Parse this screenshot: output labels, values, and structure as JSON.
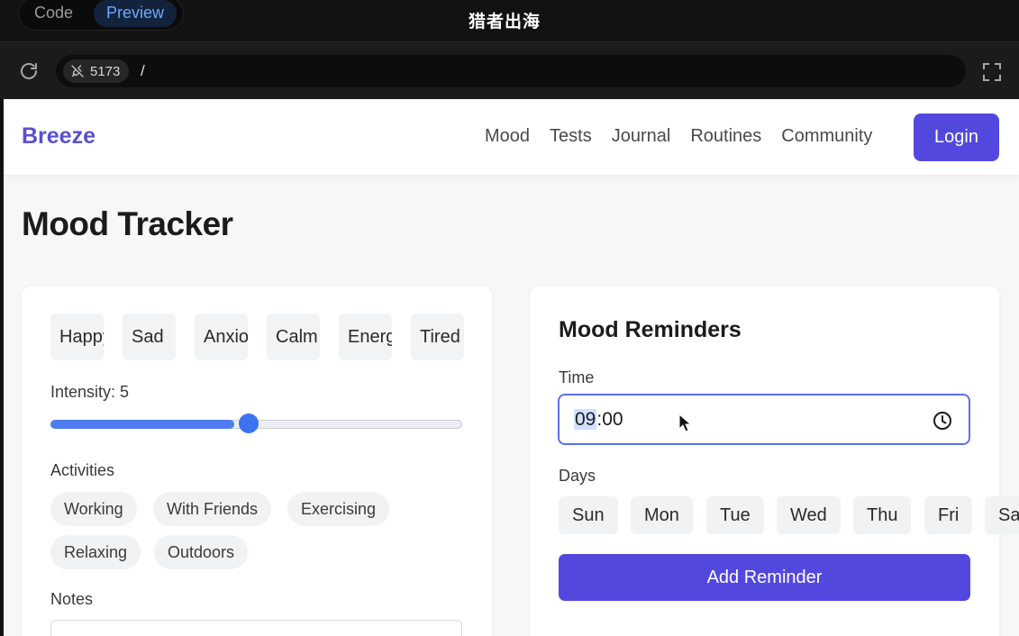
{
  "editor": {
    "tabs": {
      "code": "Code",
      "preview": "Preview"
    },
    "watermark": "猎者出海",
    "address": {
      "port": "5173",
      "path": "/"
    }
  },
  "app": {
    "brand": "Breeze",
    "nav": [
      "Mood",
      "Tests",
      "Journal",
      "Routines",
      "Community"
    ],
    "login_label": "Login",
    "page_title": "Mood Tracker",
    "moods": [
      "Happy",
      "Sad",
      "Anxious",
      "Calm",
      "Energetic",
      "Tired"
    ],
    "intensity": {
      "label": "Intensity: 5",
      "value": 5,
      "min": 1,
      "max": 10
    },
    "activities_label": "Activities",
    "activities": [
      "Working",
      "With Friends",
      "Exercising",
      "Relaxing",
      "Outdoors"
    ],
    "notes_label": "Notes",
    "reminders": {
      "title": "Mood Reminders",
      "time_label": "Time",
      "time_hour": "09",
      "time_rest": ":00",
      "days_label": "Days",
      "days": [
        "Sun",
        "Mon",
        "Tue",
        "Wed",
        "Thu",
        "Fri",
        "Sa"
      ],
      "add_label": "Add Reminder"
    }
  },
  "colors": {
    "brand": "#5a4fcf",
    "primary_button": "#5348dd",
    "slider": "#4d7df0",
    "focus_ring": "#5f6fe6"
  }
}
